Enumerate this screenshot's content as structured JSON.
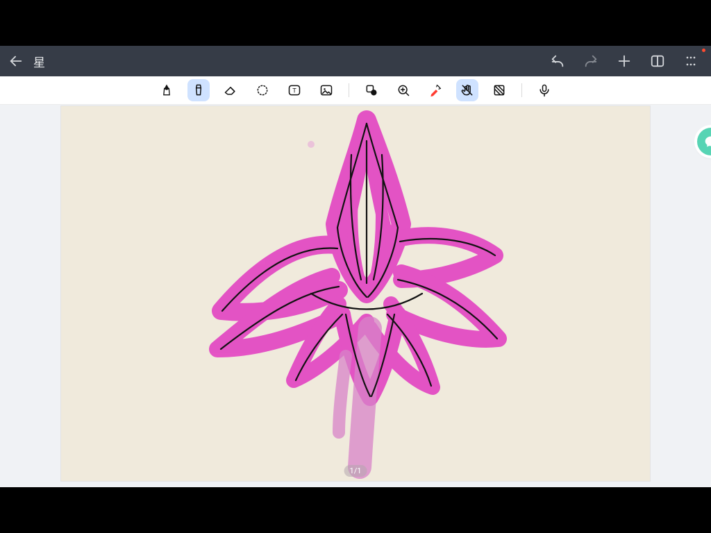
{
  "letterbox": {
    "color": "#000000"
  },
  "titlebar": {
    "title": "星",
    "back_icon": "arrow-left",
    "actions": {
      "undo_icon": "undo",
      "redo_icon": "redo",
      "add_icon": "plus",
      "panels_icon": "panel-split",
      "menu_icon": "grid-dots"
    },
    "notification_dot": true
  },
  "toolbar": {
    "tools": [
      {
        "name": "pen-tool",
        "icon": "pen-nib",
        "selected": false
      },
      {
        "name": "highlighter-tool",
        "icon": "highlighter",
        "selected": true
      },
      {
        "name": "eraser-tool",
        "icon": "eraser",
        "selected": false
      },
      {
        "name": "lasso-tool",
        "icon": "lasso",
        "selected": false
      },
      {
        "name": "text-tool",
        "icon": "text-box",
        "selected": false
      },
      {
        "name": "image-tool",
        "icon": "image",
        "selected": false
      },
      {
        "name": "separator"
      },
      {
        "name": "shapes-tool",
        "icon": "shapes",
        "selected": false
      },
      {
        "name": "zoom-tool",
        "icon": "zoom-in",
        "selected": false
      },
      {
        "name": "laser-tool",
        "icon": "laser-pointer",
        "selected": false,
        "accent": "#ff3b30"
      },
      {
        "name": "touch-lock-tool",
        "icon": "hand-off",
        "selected": true
      },
      {
        "name": "texture-tool",
        "icon": "texture",
        "selected": false
      },
      {
        "name": "separator"
      },
      {
        "name": "mic-tool",
        "icon": "microphone",
        "selected": false
      }
    ]
  },
  "side_bubble": {
    "icon": "chat-bubble"
  },
  "canvas": {
    "background": "#f0eadc",
    "page_indicator": "1/1",
    "drawing_description": "pink/magenta lotus-like flower sketch with black outline strokes and a stem",
    "drawing_colors": {
      "fill": "#e23fc1",
      "fill_light": "#e77fd1",
      "outline": "#111111"
    }
  }
}
